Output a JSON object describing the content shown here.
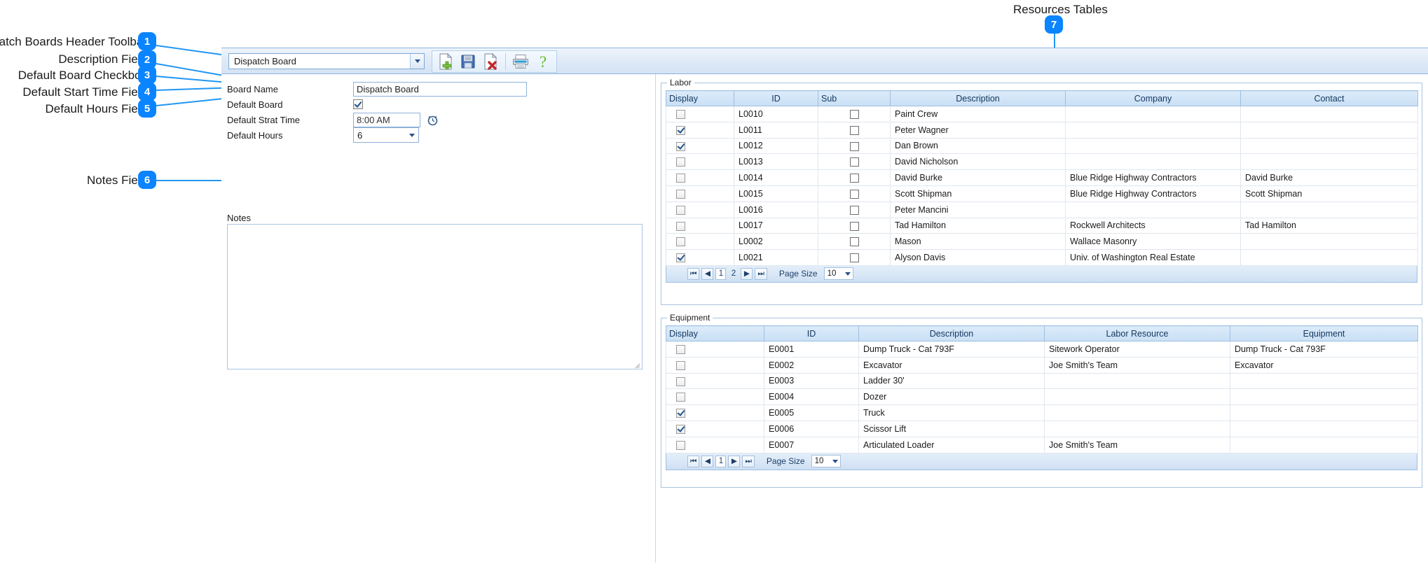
{
  "annotations": {
    "title": "Resources Tables",
    "items": [
      {
        "num": "1",
        "label": "Configure Dispatch Boards Header Toolbar"
      },
      {
        "num": "2",
        "label": "Description Field"
      },
      {
        "num": "3",
        "label": "Default Board Checkbox"
      },
      {
        "num": "4",
        "label": "Default Start Time Field"
      },
      {
        "num": "5",
        "label": "Default Hours Field"
      },
      {
        "num": "6",
        "label": "Notes Field"
      },
      {
        "num": "7",
        "label": ""
      }
    ],
    "accent_color": "#0a84ff",
    "leader_color": "#2196f3"
  },
  "toolbar": {
    "board_combo_value": "Dispatch Board",
    "buttons": [
      {
        "name": "new-board-button",
        "icon": "new-document-icon",
        "tooltip": "New"
      },
      {
        "name": "save-board-button",
        "icon": "save-floppy-icon",
        "tooltip": "Save"
      },
      {
        "name": "delete-board-button",
        "icon": "delete-document-icon",
        "tooltip": "Delete"
      },
      {
        "name": "print-button",
        "icon": "printer-icon",
        "tooltip": "Print"
      },
      {
        "name": "help-button",
        "icon": "question-mark-icon",
        "tooltip": "Help"
      }
    ]
  },
  "form": {
    "board_name_label": "Board Name",
    "board_name_value": "Dispatch Board",
    "default_board_label": "Default Board",
    "default_board_checked": true,
    "default_start_time_label": "Default Strat Time",
    "default_start_time_value": "8:00 AM",
    "clock_icon": "alarm-clock-icon",
    "default_hours_label": "Default Hours",
    "default_hours_value": "6",
    "notes_label": "Notes",
    "notes_value": ""
  },
  "labor": {
    "legend": "Labor",
    "columns": [
      "Display",
      "ID",
      "Sub",
      "Description",
      "Company",
      "Contact"
    ],
    "rows": [
      {
        "display": false,
        "id": "L0010",
        "sub": false,
        "description": "Paint Crew",
        "company": "",
        "contact": ""
      },
      {
        "display": true,
        "id": "L0011",
        "sub": false,
        "description": "Peter Wagner",
        "company": "",
        "contact": ""
      },
      {
        "display": true,
        "id": "L0012",
        "sub": false,
        "description": "Dan Brown",
        "company": "",
        "contact": ""
      },
      {
        "display": false,
        "id": "L0013",
        "sub": false,
        "description": "David Nicholson",
        "company": "",
        "contact": ""
      },
      {
        "display": false,
        "id": "L0014",
        "sub": false,
        "description": "David Burke",
        "company": "Blue Ridge Highway Contractors",
        "contact": "David Burke"
      },
      {
        "display": false,
        "id": "L0015",
        "sub": false,
        "description": "Scott Shipman",
        "company": "Blue Ridge Highway Contractors",
        "contact": "Scott Shipman"
      },
      {
        "display": false,
        "id": "L0016",
        "sub": false,
        "description": "Peter Mancini",
        "company": "",
        "contact": ""
      },
      {
        "display": false,
        "id": "L0017",
        "sub": false,
        "description": "Tad Hamilton",
        "company": "Rockwell Architects",
        "contact": "Tad Hamilton"
      },
      {
        "display": false,
        "id": "L0002",
        "sub": false,
        "description": "Mason",
        "company": "Wallace Masonry",
        "contact": ""
      },
      {
        "display": true,
        "id": "L0021",
        "sub": false,
        "description": "Alyson Davis",
        "company": "Univ. of Washington Real Estate",
        "contact": ""
      }
    ],
    "pager": {
      "first": "⏮",
      "prev": "◀",
      "next": "▶",
      "last": "⏭",
      "pages": [
        "1",
        "2"
      ],
      "active_page": "1",
      "page_size_label": "Page Size",
      "page_size_value": "10"
    }
  },
  "equipment": {
    "legend": "Equipment",
    "columns": [
      "Display",
      "ID",
      "Description",
      "Labor Resource",
      "Equipment"
    ],
    "rows": [
      {
        "display": false,
        "id": "E0001",
        "description": "Dump Truck - Cat 793F",
        "labor_resource": "Sitework Operator",
        "equipment": "Dump Truck - Cat 793F"
      },
      {
        "display": false,
        "id": "E0002",
        "description": "Excavator",
        "labor_resource": "Joe Smith's Team",
        "equipment": "Excavator"
      },
      {
        "display": false,
        "id": "E0003",
        "description": "Ladder 30'",
        "labor_resource": "",
        "equipment": ""
      },
      {
        "display": false,
        "id": "E0004",
        "description": "Dozer",
        "labor_resource": "",
        "equipment": ""
      },
      {
        "display": true,
        "id": "E0005",
        "description": "Truck",
        "labor_resource": "",
        "equipment": ""
      },
      {
        "display": true,
        "id": "E0006",
        "description": "Scissor Lift",
        "labor_resource": "",
        "equipment": ""
      },
      {
        "display": false,
        "id": "E0007",
        "description": "Articulated Loader",
        "labor_resource": "Joe Smith's Team",
        "equipment": ""
      }
    ],
    "pager": {
      "first": "⏮",
      "prev": "◀",
      "next": "▶",
      "last": "⏭",
      "pages": [
        "1"
      ],
      "active_page": "1",
      "page_size_label": "Page Size",
      "page_size_value": "10"
    }
  }
}
